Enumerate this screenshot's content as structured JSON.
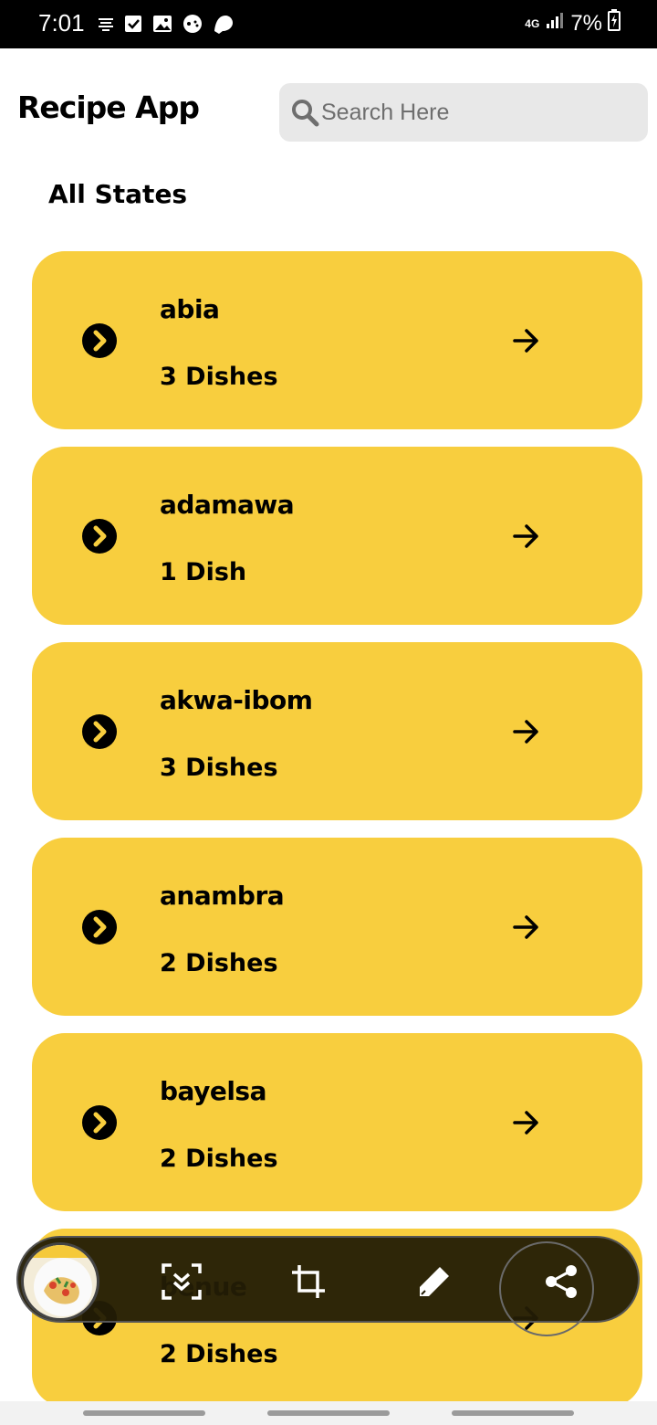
{
  "status_bar": {
    "time": "7:01",
    "network": "4G",
    "battery": "7%",
    "icons": [
      "sync-icon",
      "checkbox-icon",
      "image-icon",
      "gamepad-icon",
      "bird-icon",
      "signal-icon",
      "battery-charging-icon"
    ]
  },
  "header": {
    "title": "Recipe App",
    "search_placeholder": "Search Here",
    "search_value": ""
  },
  "section": {
    "title": "All States"
  },
  "states": [
    {
      "name": "abia",
      "dishes": "3 Dishes"
    },
    {
      "name": "adamawa",
      "dishes": "1 Dish"
    },
    {
      "name": "akwa-ibom",
      "dishes": "3 Dishes"
    },
    {
      "name": "anambra",
      "dishes": "2 Dishes"
    },
    {
      "name": "bayelsa",
      "dishes": "2 Dishes"
    },
    {
      "name": "benue",
      "dishes": "2 Dishes"
    }
  ],
  "overlay_toolbar": {
    "buttons": [
      "scroll-capture-icon",
      "crop-icon",
      "edit-pen-icon",
      "share-icon"
    ]
  },
  "colors": {
    "card": "#f8ce3e",
    "status_bar": "#000000",
    "search_bg": "#e8e8e8",
    "overlay_bg": "#231c05"
  }
}
